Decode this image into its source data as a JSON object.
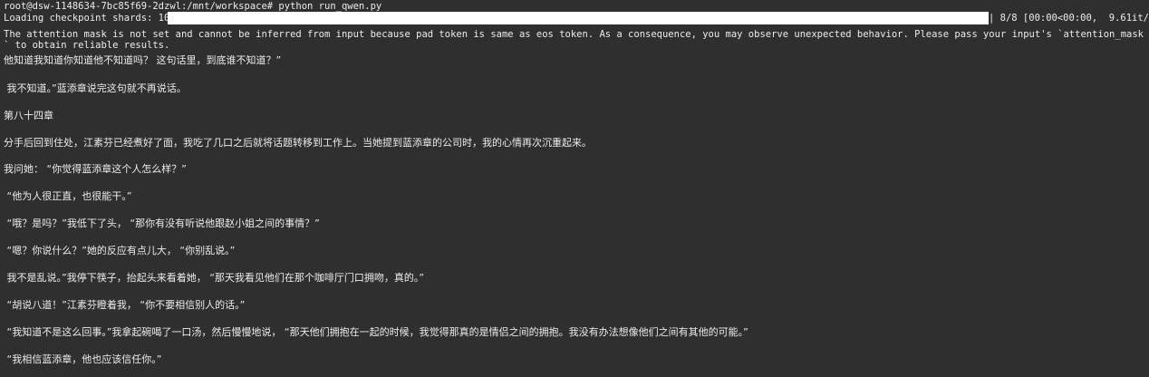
{
  "terminal": {
    "prompt_line": "root@dsw-1148634-7bc85f69-2dzwl:/mnt/workspace# python run_qwen.py",
    "progress": {
      "prefix": "Loading checkpoint shards: 100%|",
      "suffix": "| 8/8 [00:00<00:00,  9.61it/s]",
      "fraction": 1.0
    },
    "warning": "The attention mask is not set and cannot be inferred from input because pad token is same as eos token. As a consequence, you may observe unexpected behavior. Please pass your input's `attention_mask` to obtain reliable results.",
    "output_lines": [
      "他知道我知道你知道他不知道吗？ 这句话里，到底谁不知道？”",
      " 我不知道。”蓝添章说完这句就不再说话。",
      "第八十四章",
      "分手后回到住处，江素芬已经煮好了面，我吃了几口之后就将话题转移到工作上。当她提到蓝添章的公司时，我的心情再次沉重起来。",
      "我问她： “你觉得蓝添章这个人怎么样？”",
      " “他为人很正直，也很能干。”",
      " “哦？是吗？”我低下了头， “那你有没有听说他跟赵小姐之间的事情？”",
      " “嗯？你说什么？”她的反应有点儿大， “你别乱说。”",
      " 我不是乱说。”我停下筷子，抬起头来看着她， “那天我看见他们在那个咖啡厅门口拥吻，真的。”",
      " “胡说八道！”江素芬瞪着我， “你不要相信别人的话。”",
      " “我知道不是这么回事。”我拿起碗喝了一口汤，然后慢慢地说， “那天他们拥抱在一起的时候，我觉得那真的是情侣之间的拥抱。我没有办法想像他们之间有其他的可能。”",
      " “我相信蓝添章，他也应该信任你。”"
    ]
  }
}
